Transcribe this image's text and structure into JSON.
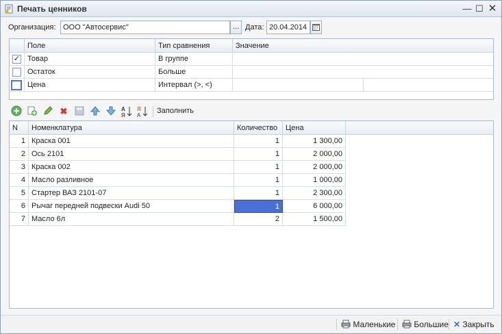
{
  "window": {
    "title": "Печать ценников"
  },
  "form": {
    "org_label": "Организация:",
    "org_value": "ООО \"Автосервис\"",
    "org_button": "...",
    "date_label": "Дата:",
    "date_value": "20.04.2014"
  },
  "filter": {
    "headers": [
      "Поле",
      "Тип сравнения",
      "Значение"
    ],
    "rows": [
      {
        "checked": true,
        "field": "Товар",
        "compare": "В группе",
        "value": ""
      },
      {
        "checked": false,
        "field": "Остаток",
        "compare": "Больше",
        "value": ""
      },
      {
        "checked": false,
        "field": "Цена",
        "compare": "Интервал (>, <)",
        "value": ""
      }
    ]
  },
  "toolbar": {
    "fill_label": "Заполнить"
  },
  "table": {
    "headers": [
      "N",
      "Номенклатура",
      "Количество",
      "Цена"
    ],
    "rows": [
      {
        "n": "1",
        "name": "Краска 001",
        "qty": "1",
        "price": "1 300,00"
      },
      {
        "n": "2",
        "name": "Ось 2101",
        "qty": "1",
        "price": "2 000,00"
      },
      {
        "n": "3",
        "name": "Краска 002",
        "qty": "1",
        "price": "2 000,00"
      },
      {
        "n": "4",
        "name": "Масло разливное",
        "qty": "1",
        "price": "1 000,00"
      },
      {
        "n": "5",
        "name": "Стартер ВАЗ 2101-07",
        "qty": "1",
        "price": "2 300,00"
      },
      {
        "n": "6",
        "name": "Рычаг передней подвески Audi 50",
        "qty": "1",
        "price": "6 000,00"
      },
      {
        "n": "7",
        "name": "Масло 6л",
        "qty": "2",
        "price": "1 500,00"
      }
    ],
    "selected_row": 6
  },
  "footer": {
    "small_label": "Маленькие",
    "big_label": "Большие",
    "close_label": "Закрыть"
  }
}
